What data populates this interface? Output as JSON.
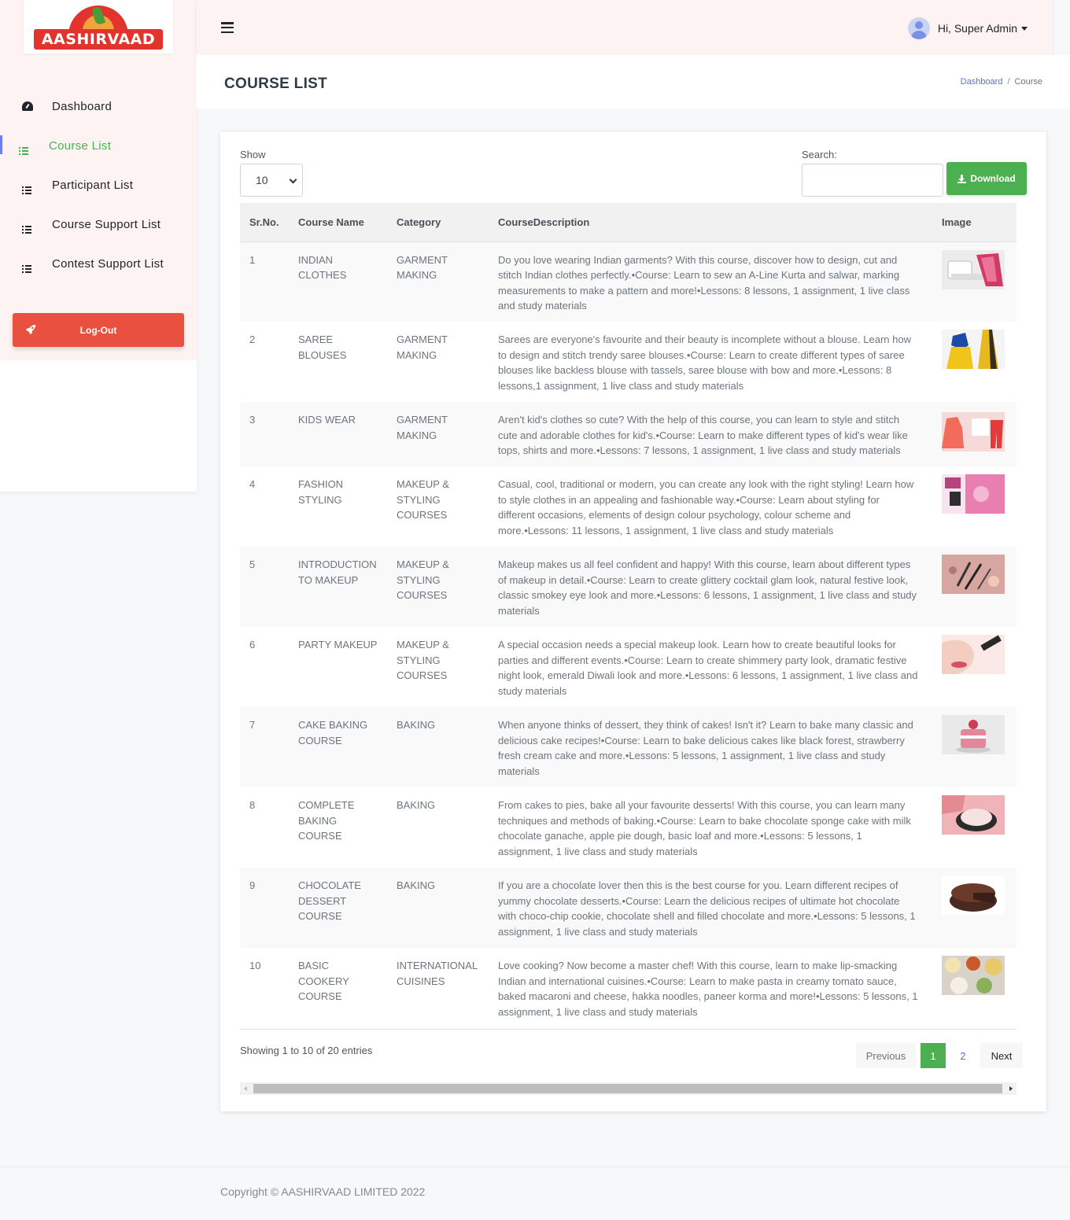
{
  "brand": {
    "logo_text": "AASHIRVAAD"
  },
  "sidebar": {
    "items": [
      {
        "label": "Dashboard",
        "icon": "dashboard-icon",
        "active": false
      },
      {
        "label": "Course List",
        "icon": "list-icon",
        "active": true
      },
      {
        "label": "Participant List",
        "icon": "list-icon",
        "active": false
      },
      {
        "label": "Course Support List",
        "icon": "list-icon",
        "active": false
      },
      {
        "label": "Contest Support List",
        "icon": "list-icon",
        "active": false
      }
    ],
    "logout_label": "Log-Out"
  },
  "header": {
    "user_greeting": "Hi, Super Admin"
  },
  "page": {
    "title": "COURSE LIST",
    "breadcrumb": {
      "home": "Dashboard",
      "separator": "/",
      "current": "Course"
    }
  },
  "controls": {
    "show_label": "Show",
    "show_value": "10",
    "search_label": "Search:",
    "search_value": "",
    "download_label": "Download"
  },
  "table": {
    "columns": [
      "Sr.No.",
      "Course Name",
      "Category",
      "CourseDescription",
      "Image"
    ],
    "rows": [
      {
        "sr": "1",
        "name": "INDIAN CLOTHES",
        "category": "GARMENT MAKING",
        "description": "Do you love wearing Indian garments? With this course, discover how to design, cut and stitch Indian clothes perfectly.•Course: Learn to sew an A-Line Kurta and salwar, marking measurements to make a pattern and more!•Lessons: 8 lessons, 1 assignment, 1 live class and study materials"
      },
      {
        "sr": "2",
        "name": "SAREE BLOUSES",
        "category": "GARMENT MAKING",
        "description": "Sarees are everyone's favourite and their beauty is incomplete without a blouse. Learn how to design and stitch trendy saree blouses.•Course: Learn to create different types of saree blouses like backless blouse with tassels, saree blouse with bow and more.•Lessons: 8 lessons,1 assignment, 1 live class and study materials"
      },
      {
        "sr": "3",
        "name": "KIDS WEAR",
        "category": "GARMENT MAKING",
        "description": "Aren't kid's clothes so cute? With the help of this course, you can learn to style and stitch cute and adorable clothes for kid's.•Course: Learn to make different types of kid's wear like tops, shirts and more.•Lessons: 7 lessons, 1 assignment, 1 live class and study materials"
      },
      {
        "sr": "4",
        "name": "FASHION STYLING",
        "category": "MAKEUP & STYLING COURSES",
        "description": "Casual, cool, traditional or modern, you can create any look with the right styling! Learn how to style clothes in an appealing and fashionable way.•Course: Learn about styling for different occasions, elements of design colour psychology, colour scheme and more.•Lessons: 11 lessons, 1 assignment, 1 live class and study materials"
      },
      {
        "sr": "5",
        "name": "INTRODUCTION TO MAKEUP",
        "category": "MAKEUP & STYLING COURSES",
        "description": "Makeup makes us all feel confident and happy! With this course, learn about different types of makeup in detail.•Course: Learn to create glittery cocktail glam look, natural festive look, classic smokey eye look and more.•Lessons: 6 lessons, 1 assignment, 1 live class and study materials"
      },
      {
        "sr": "6",
        "name": "PARTY MAKEUP",
        "category": "MAKEUP & STYLING COURSES",
        "description": "A special occasion needs a special makeup look. Learn how to create beautiful looks for parties and different events.•Course: Learn to create shimmery party look, dramatic festive night look, emerald Diwali look and more.•Lessons: 6 lessons, 1 assignment, 1 live class and study materials"
      },
      {
        "sr": "7",
        "name": "CAKE BAKING COURSE",
        "category": "BAKING",
        "description": "When anyone thinks of dessert, they think of cakes! Isn't it? Learn to bake many classic and delicious cake recipes!•Course: Learn to bake delicious cakes like black forest, strawberry fresh cream cake and more.•Lessons: 5 lessons, 1 assignment, 1 live class and study materials"
      },
      {
        "sr": "8",
        "name": "COMPLETE BAKING COURSE",
        "category": "BAKING",
        "description": "From cakes to pies, bake all your favourite desserts! With this course, you can learn many techniques and methods of baking.•Course: Learn to bake chocolate sponge cake with milk chocolate ganache, apple pie dough, basic loaf and more.•Lessons: 5 lessons, 1 assignment, 1 live class and study materials"
      },
      {
        "sr": "9",
        "name": "CHOCOLATE DESSERT COURSE",
        "category": "BAKING",
        "description": "If you are a chocolate lover then this is the best course for you. Learn different recipes of yummy chocolate desserts.•Course: Learn the delicious recipes of ultimate hot chocolate with choco-chip cookie, chocolate shell and filled chocolate and more.•Lessons: 5 lessons, 1 assignment, 1 live class and study materials"
      },
      {
        "sr": "10",
        "name": "BASIC COOKERY COURSE",
        "category": "INTERNATIONAL CUISINES",
        "description": "Love cooking? Now become a master chef! With this course, learn to make lip-smacking Indian and international cuisines.•Course: Learn to make pasta in creamy tomato sauce, baked macaroni and cheese, hakka noodles, paneer korma and more!•Lessons: 5 lessons, 1 assignment, 1 live class and study materials"
      }
    ]
  },
  "pagination": {
    "info": "Showing 1 to 10 of 20 entries",
    "previous": "Previous",
    "pages": [
      "1",
      "2"
    ],
    "current": "1",
    "next": "Next"
  },
  "footer": {
    "copyright": "Copyright © AASHIRVAAD LIMITED 2022"
  },
  "colors": {
    "accent_green": "#4caf50",
    "logout_red": "#e9503f",
    "header_bg": "#fdf3f2",
    "link_blue": "#5a6fd6"
  }
}
